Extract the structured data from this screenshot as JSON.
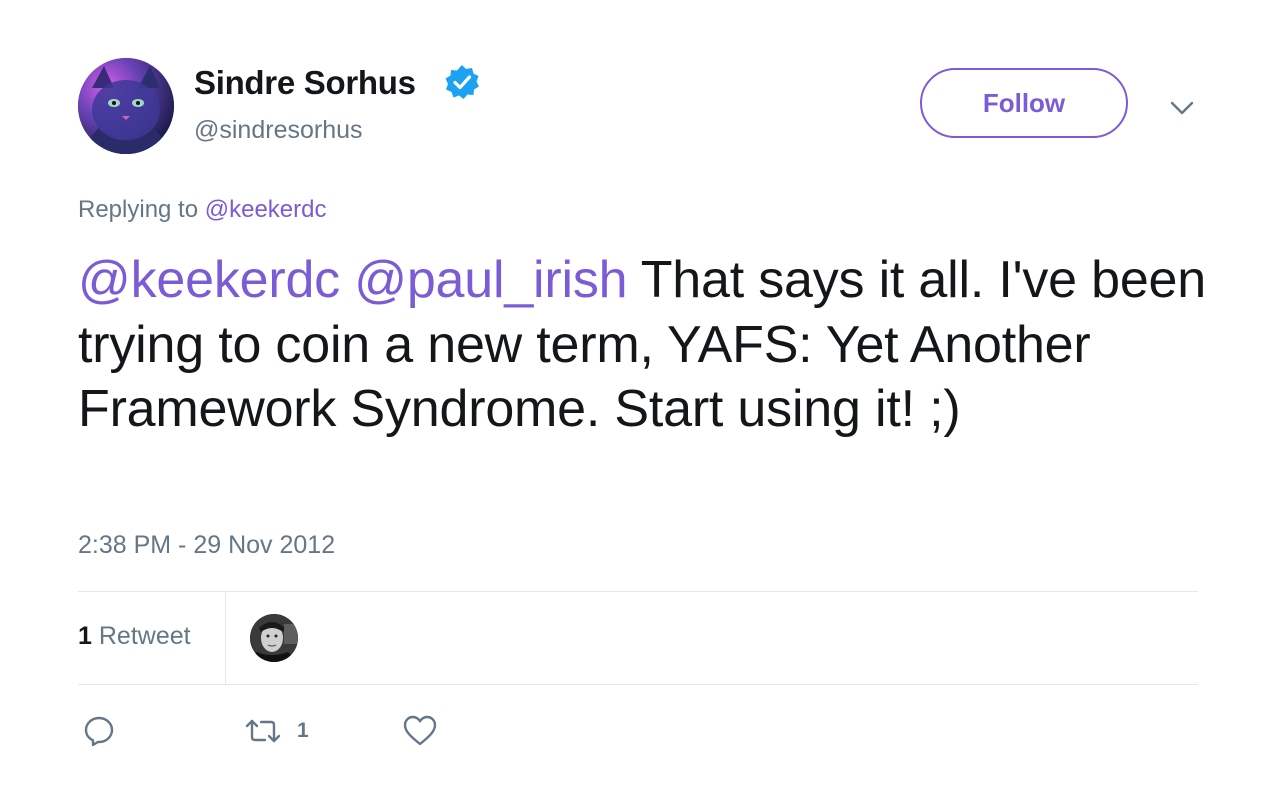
{
  "author": {
    "display_name": "Sindre Sorhus",
    "handle": "@sindresorhus",
    "verified": true,
    "avatar_icon": "cat-avatar"
  },
  "actions": {
    "follow_label": "Follow",
    "menu_icon": "chevron-down-icon"
  },
  "reply_context": {
    "prefix": "Replying to",
    "mention": "@keekerdc"
  },
  "tweet": {
    "mention_1": "@keekerdc",
    "mention_2": "@paul_irish",
    "text": "That says it all. I've been trying to coin a new term, YAFS: Yet Another Framework Syndrome. Start using it! ;)",
    "timestamp": "2:38 PM - 29 Nov 2012"
  },
  "stats": {
    "retweet_count": "1",
    "retweet_label": "Retweet"
  },
  "footer_actions": {
    "reply_icon": "reply-icon",
    "retweet_icon": "retweet-icon",
    "retweet_count": "1",
    "like_icon": "heart-icon"
  },
  "colors": {
    "accent": "#7c5cd6",
    "secondary_text": "#657786",
    "primary_text": "#14171a",
    "verified_badge": "#1da1f2",
    "divider": "#e1e8ed"
  }
}
